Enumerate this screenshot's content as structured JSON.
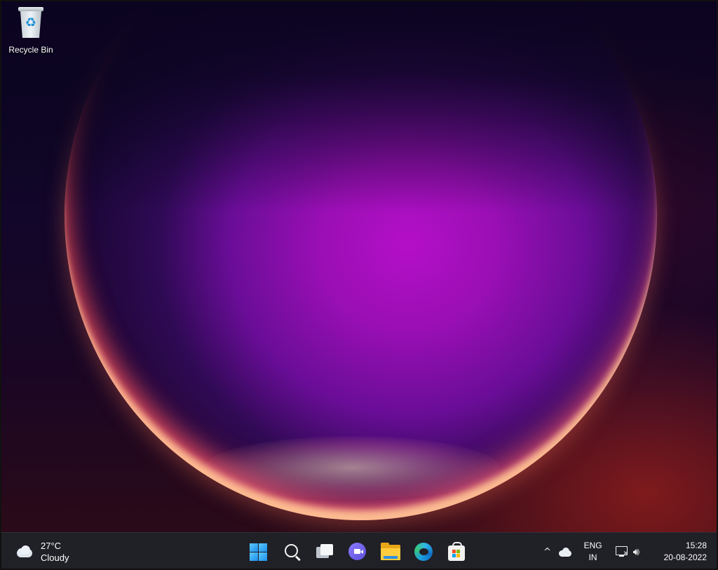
{
  "desktop": {
    "icons": [
      {
        "label": "Recycle Bin",
        "icon": "recycle-bin-icon"
      }
    ]
  },
  "taskbar": {
    "weather": {
      "temperature": "27°C",
      "condition": "Cloudy",
      "icon": "cloud-icon"
    },
    "pinned": [
      {
        "name": "start",
        "icon": "windows-logo-icon"
      },
      {
        "name": "search",
        "icon": "search-icon"
      },
      {
        "name": "task-view",
        "icon": "task-view-icon"
      },
      {
        "name": "chat",
        "icon": "teams-chat-icon"
      },
      {
        "name": "file-explorer",
        "icon": "folder-icon"
      },
      {
        "name": "edge",
        "icon": "edge-browser-icon"
      },
      {
        "name": "store",
        "icon": "microsoft-store-icon"
      }
    ],
    "tray": {
      "chevron": "^",
      "language_line1": "ENG",
      "language_line2": "IN",
      "time": "15:28",
      "date": "20-08-2022"
    }
  },
  "colors": {
    "taskbar": "#202027",
    "windows_blue": "#1a8fe8",
    "folder_yellow": "#ffcc3d",
    "orb_magenta": "#b40fc8"
  }
}
